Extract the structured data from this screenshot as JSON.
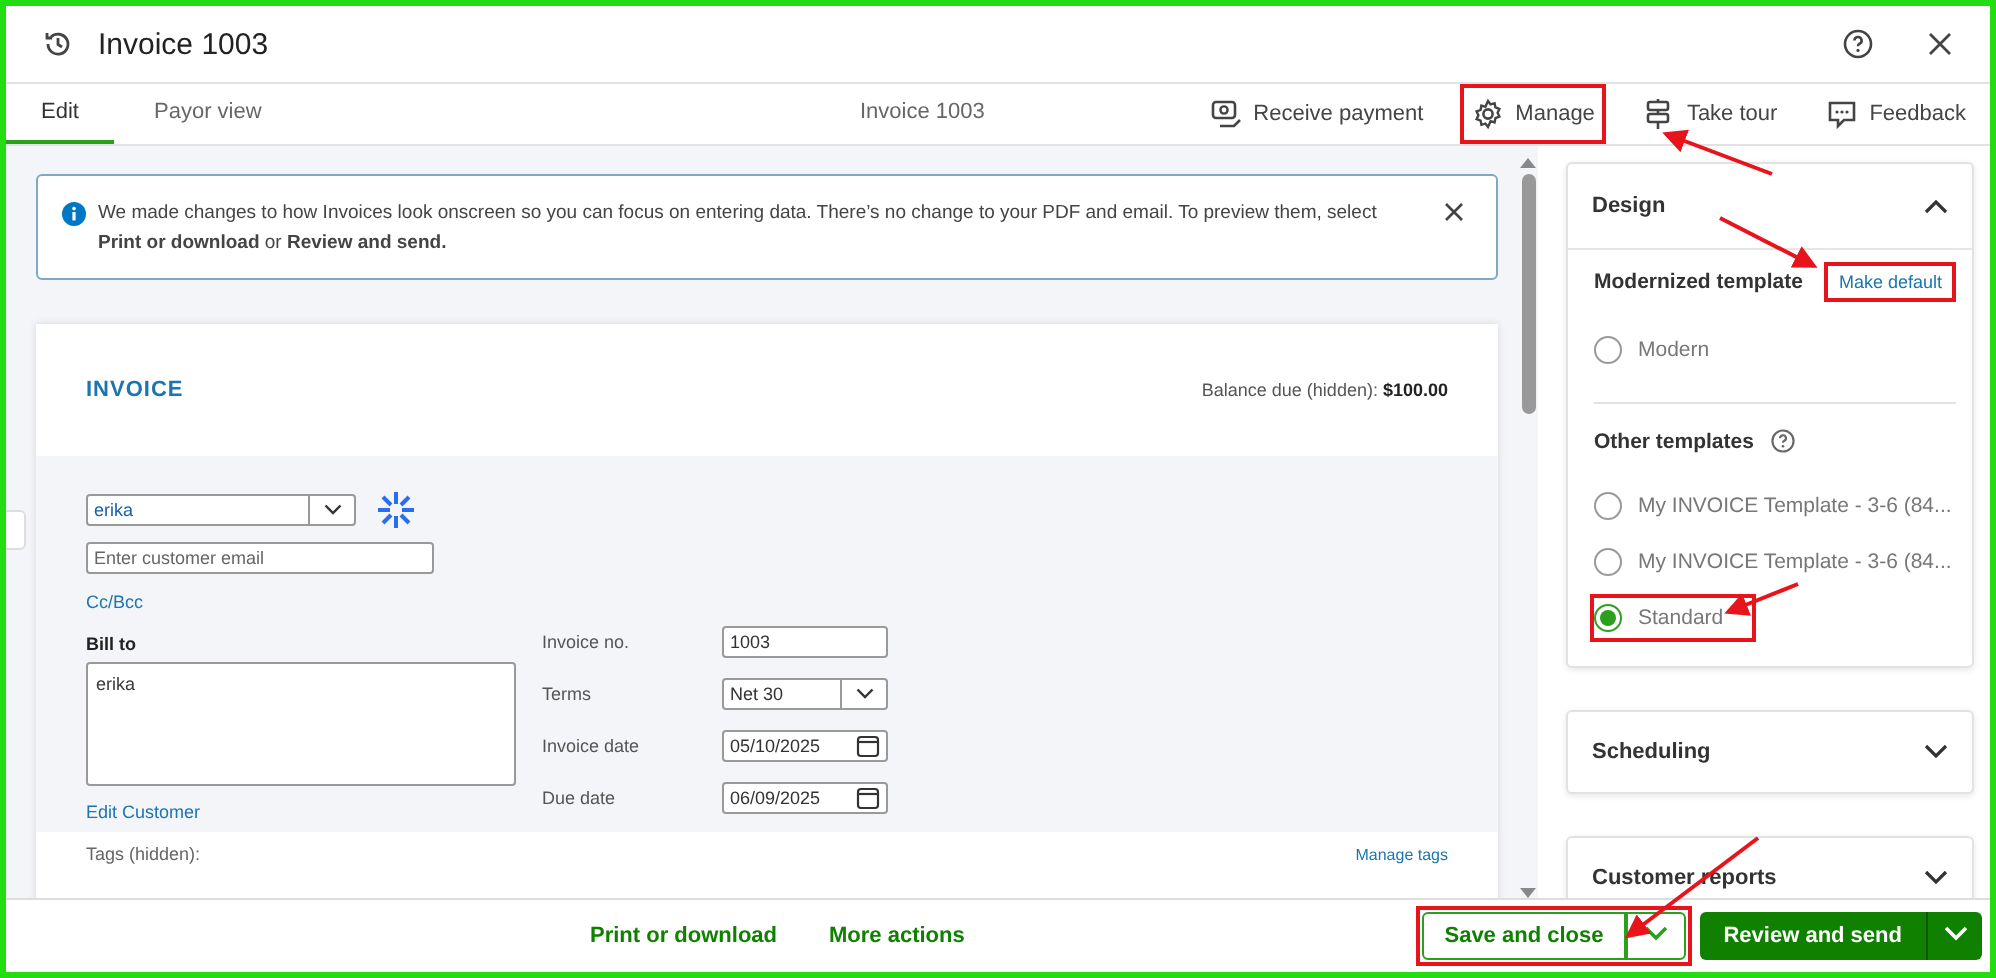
{
  "header": {
    "title": "Invoice 1003"
  },
  "tabs": [
    {
      "label": "Edit",
      "selected": true
    },
    {
      "label": "Payor view",
      "selected": false
    }
  ],
  "center_title": "Invoice 1003",
  "actions": [
    {
      "label": "Receive payment",
      "kind": "payment",
      "highlighted": false
    },
    {
      "label": "Manage",
      "kind": "gear",
      "highlighted": true
    },
    {
      "label": "Take tour",
      "kind": "tour",
      "highlighted": false
    },
    {
      "label": "Feedback",
      "kind": "feedback",
      "highlighted": false
    }
  ],
  "notice": {
    "text": "We made changes to how Invoices look onscreen so you can focus on entering data. There’s no change to your PDF and email. To preview them, select **Print or download** or **Review and send.**"
  },
  "invoice": {
    "heading": "INVOICE",
    "balance_label": "Balance due (hidden):",
    "balance": "$100.00",
    "customer": "erika",
    "email_placeholder": "Enter customer email",
    "cc_link": "Cc/Bcc",
    "bill_to_label": "Bill to",
    "bill_to": "erika",
    "edit_link": "Edit Customer",
    "fields": [
      {
        "label": "Invoice no.",
        "value": "1003",
        "kind": "text"
      },
      {
        "label": "Terms",
        "value": "Net 30",
        "kind": "select"
      },
      {
        "label": "Invoice date",
        "value": "05/10/2025",
        "kind": "date"
      },
      {
        "label": "Due date",
        "value": "06/09/2025",
        "kind": "date"
      }
    ],
    "tags_label": "Tags (hidden):",
    "manage_tags": "Manage tags"
  },
  "design": {
    "title": "Design",
    "expanded": true,
    "modern_heading": "Modernized template",
    "make_default": {
      "label": "Make default",
      "highlighted": true
    },
    "modern_options": [
      {
        "label": "Modern",
        "selected": false,
        "highlighted": false
      }
    ],
    "other_heading": "Other templates",
    "other_options": [
      {
        "label": "My INVOICE Template - 3-6 (84...",
        "selected": false,
        "highlighted": false
      },
      {
        "label": "My INVOICE Template - 3-6 (84...",
        "selected": false,
        "highlighted": false
      },
      {
        "label": "Standard",
        "selected": true,
        "highlighted": true
      }
    ]
  },
  "sections": [
    {
      "title": "Scheduling",
      "expanded": false
    },
    {
      "title": "Customer reports",
      "expanded": false
    }
  ],
  "footer": {
    "links": [
      "Print or download",
      "More actions"
    ],
    "save": {
      "label": "Save and close",
      "highlighted": true
    },
    "primary": {
      "label": "Review and send"
    }
  }
}
